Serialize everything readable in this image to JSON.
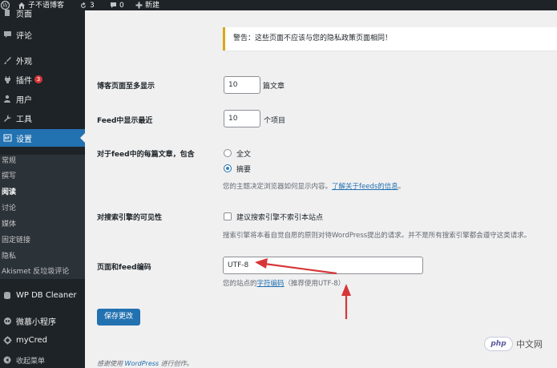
{
  "admin_bar": {
    "site_name": "子不语博客",
    "updates_count": "3",
    "comments_count": "0",
    "new_label": "新建"
  },
  "sidebar": {
    "items": [
      {
        "label": "页面",
        "icon": "page-icon"
      },
      {
        "label": "评论",
        "icon": "comment-icon"
      },
      {
        "label": "外观",
        "icon": "appearance-icon"
      },
      {
        "label": "插件",
        "icon": "plugin-icon",
        "badge": "3"
      },
      {
        "label": "用户",
        "icon": "user-icon"
      },
      {
        "label": "工具",
        "icon": "wrench-icon"
      },
      {
        "label": "设置",
        "icon": "settings-icon",
        "current": true
      }
    ],
    "submenu": [
      "常规",
      "撰写",
      "阅读",
      "讨论",
      "媒体",
      "固定链接",
      "隐私",
      "Akismet 反垃圾评论"
    ],
    "bottom_items": [
      {
        "label": "WP DB Cleaner",
        "icon": "database-icon"
      },
      {
        "label": "微慕小程序",
        "icon": "miniprogram-icon"
      },
      {
        "label": "myCred",
        "icon": "gear-icon"
      },
      {
        "label": "收起菜单",
        "icon": "collapse-icon"
      }
    ]
  },
  "notice": {
    "text": "警告：这些页面不应该与您的隐私政策页面相同！"
  },
  "settings": {
    "posts_per_page": {
      "label": "博客页面至多显示",
      "value": "10",
      "suffix": "篇文章"
    },
    "posts_per_rss": {
      "label": "Feed中显示最近",
      "value": "10",
      "suffix": "个项目"
    },
    "rss_use_excerpt": {
      "label": "对于feed中的每篇文章，包含",
      "options": [
        "全文",
        "摘要"
      ],
      "selected": "摘要",
      "desc_prefix": "您的主题决定浏览器如何显示内容。",
      "desc_link": "了解关于feeds的信息",
      "desc_suffix": "。"
    },
    "blog_public": {
      "label": "对搜索引擎的可见性",
      "checkbox_label": "建议搜索引擎不索引本站点",
      "checked": false,
      "desc": "搜索引擎将本着自觉自愿的原则对待WordPress提出的请求。并不是所有搜索引擎都会遵守这类请求。"
    },
    "blog_charset": {
      "label": "页面和feed编码",
      "value": "UTF-8",
      "desc_prefix": "您的站点的",
      "desc_link": "字符编码",
      "desc_suffix": "（推荐使用UTF-8）"
    }
  },
  "save_button": "保存更改",
  "footer": {
    "prefix": "感谢使用",
    "link": "WordPress",
    "suffix": "进行创作。"
  },
  "watermark": {
    "logo_text": "php",
    "text": "中文网"
  },
  "colors": {
    "admin_dark": "#1d2327",
    "accent": "#2271b1",
    "annotation_red": "#d63638",
    "warning": "#dba617"
  }
}
